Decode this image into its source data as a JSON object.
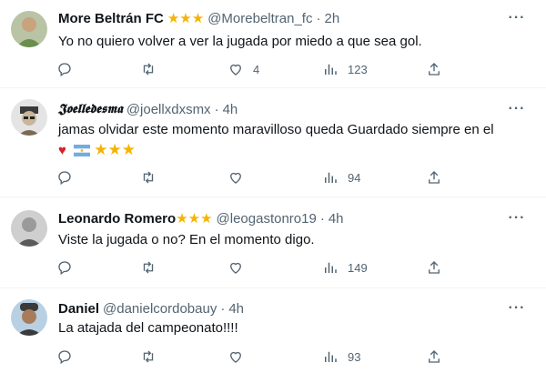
{
  "tweets": [
    {
      "name": "More Beltrán FC",
      "stars": "★★★",
      "handle": "@Morebeltran_fc",
      "time": "2h",
      "text": "Yo no quiero volver a ver la jugada por miedo a que sea gol.",
      "likes": "4",
      "views": "123",
      "avatar_colors": [
        "#c9a27e",
        "#6b8e4e"
      ]
    },
    {
      "name": "𝕵𝖔𝖊𝖑𝖑𝖊𝖉𝖊𝖘𝖒𝖆",
      "stars": "",
      "handle": "@joellxdxsmx",
      "time": "4h",
      "text": "jamas olvidar este momento  maravilloso queda Guardado  siempre  en el",
      "text2_heart": "♥",
      "text2_flag": "🇦🇷",
      "text2_stars": "★★★",
      "likes": "",
      "views": "94",
      "avatar_colors": [
        "#d9d9d9",
        "#7a6a55"
      ]
    },
    {
      "name": "Leonardo Romero",
      "stars": "★★★",
      "handle": "@leogastonro19",
      "time": "4h",
      "text": "Viste la jugada o no? En el momento digo.",
      "likes": "",
      "views": "149",
      "avatar_colors": [
        "#9a9a9a",
        "#5a5a5a"
      ]
    },
    {
      "name": "Daniel",
      "stars": "",
      "handle": "@danielcordobauy",
      "time": "4h",
      "text": "La atajada del campeonato!!!!",
      "likes": "",
      "views": "93",
      "avatar_colors": [
        "#a87c5a",
        "#3a3a3a"
      ]
    }
  ],
  "ui": {
    "more": "···",
    "dot": "·"
  },
  "colors": {
    "accent_gray": "#536471",
    "star": "#f4b400",
    "divider": "#eff3f4"
  },
  "icons": [
    "reply-icon",
    "retweet-icon",
    "like-icon",
    "views-icon",
    "share-icon",
    "more-icon"
  ]
}
